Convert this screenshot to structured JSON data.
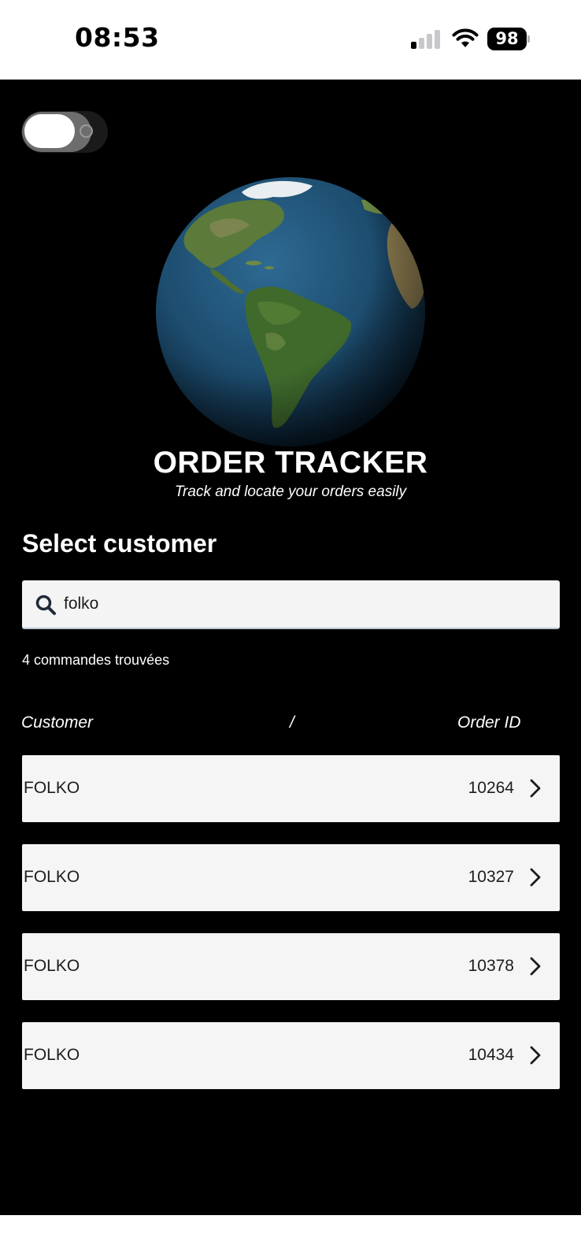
{
  "status_bar": {
    "time": "08:53",
    "battery": "98",
    "icons": [
      "signal-icon",
      "wifi-icon",
      "battery-icon"
    ]
  },
  "theme": {
    "background": "#000000",
    "row_background": "#f5f5f5",
    "text_light": "#ffffff",
    "text_dark": "#1d1d1d"
  },
  "header": {
    "toggle": "theme-toggle",
    "title": "ORDER TRACKER",
    "subtitle": "Track and locate your orders easily"
  },
  "customer_select": {
    "heading": "Select customer",
    "search_value": "folko",
    "results_text": "4 commandes trouvées"
  },
  "table": {
    "columns": {
      "customer": "Customer",
      "separator": "/",
      "order_id": "Order ID"
    },
    "rows": [
      {
        "customer": "FOLKO",
        "order_id": "10264"
      },
      {
        "customer": "FOLKO",
        "order_id": "10327"
      },
      {
        "customer": "FOLKO",
        "order_id": "10378"
      },
      {
        "customer": "FOLKO",
        "order_id": "10434"
      }
    ]
  }
}
